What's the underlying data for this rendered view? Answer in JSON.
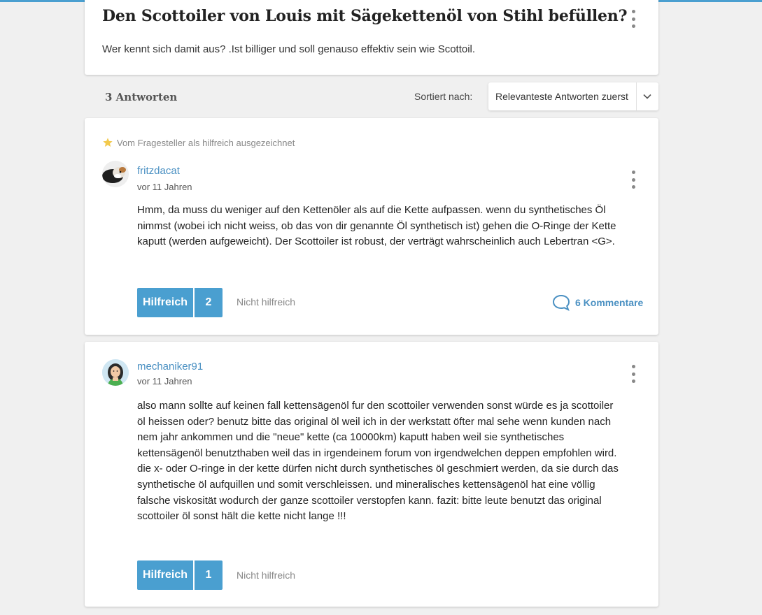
{
  "question": {
    "title": "Den Scottoiler von Louis mit Sägekettenöl von Stihl befüllen?",
    "text": "Wer kennt sich damit aus? .Ist billiger und soll genauso effektiv sein wie Scottoil."
  },
  "answers_bar": {
    "count_label": "3 Antworten",
    "sort_label": "Sortiert nach:",
    "sort_value": "Relevanteste Antworten zuerst"
  },
  "answers": [
    {
      "badge": "Vom Fragesteller als hilfreich ausgezeichnet",
      "username": "fritzdacat",
      "date": "vor 11 Jahren",
      "text": "Hmm, da muss du weniger auf den Kettenöler als auf die Kette aufpassen. wenn du synthetisches Öl nimmst (wobei ich nicht weiss, ob das von dir genannte Öl synthetisch ist) gehen die O-Ringe der Kette kaputt (werden aufgeweicht). Der Scottoiler ist robust, der verträgt wahrscheinlich auch Lebertran <G>.",
      "helpful_label": "Hilfreich",
      "helpful_count": "2",
      "not_helpful_label": "Nicht hilfreich",
      "comments_label": "6 Kommentare"
    },
    {
      "username": "mechaniker91",
      "date": "vor 11 Jahren",
      "text": "also mann sollte auf keinen fall kettensägenöl fur den scottoiler verwenden sonst würde es ja scottoiler öl heissen oder? benutz bitte das original öl weil ich in der werkstatt öfter mal sehe wenn kunden nach nem jahr ankommen und die \"neue\" kette (ca 10000km) kaputt haben weil sie synthetisches kettensägenöl benutzthaben weil das in irgendeinem forum von irgendwelchen deppen empfohlen wird. die x- oder O-ringe in der kette dürfen nicht durch synthetisches öl geschmiert werden, da sie durch das synthetische öl aufquillen und somit verschleissen. und mineralisches kettensägenöl hat eine völlig falsche viskosität wodurch der ganze scottoiler verstopfen kann. fazit: bitte leute benutzt das original scottoiler öl sonst hält die kette nicht lange !!!",
      "helpful_label": "Hilfreich",
      "helpful_count": "1",
      "not_helpful_label": "Nicht hilfreich"
    }
  ],
  "colors": {
    "accent": "#4a9fd0",
    "link": "#4a90c2",
    "star": "#f2c94c",
    "background": "#f0f0f0"
  },
  "icons": [
    "more-vertical-icon",
    "chevron-down-icon",
    "star-icon",
    "comment-bubble-icon"
  ]
}
